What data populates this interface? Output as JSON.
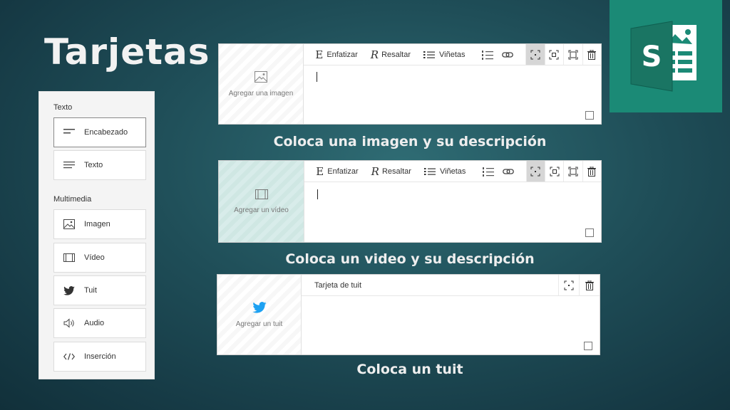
{
  "slide": {
    "title": "Tarjetas"
  },
  "logo": {
    "letter": "S",
    "color": "#1b8a76"
  },
  "panel": {
    "sections": [
      {
        "title": "Texto",
        "items": [
          {
            "label": "Encabezado",
            "icon": "heading-icon",
            "selected": true
          },
          {
            "label": "Texto",
            "icon": "text-lines-icon"
          }
        ]
      },
      {
        "title": "Multimedia",
        "items": [
          {
            "label": "Imagen",
            "icon": "image-icon"
          },
          {
            "label": "Vídeo",
            "icon": "video-icon"
          },
          {
            "label": "Tuit",
            "icon": "twitter-icon"
          },
          {
            "label": "Audio",
            "icon": "speaker-icon"
          },
          {
            "label": "Inserción",
            "icon": "embed-icon"
          }
        ]
      }
    ]
  },
  "toolbar": {
    "emphasize_glyph": "E",
    "emphasize": "Enfatizar",
    "highlight_glyph": "R",
    "highlight": "Resaltar",
    "bullets": "Viñetas"
  },
  "cards": {
    "image": {
      "media_label": "Agregar una imagen",
      "caption": "Coloca una imagen y su descripción"
    },
    "video": {
      "media_label": "Agregar un vídeo",
      "caption": "Coloca un video y su descripción"
    },
    "tweet": {
      "media_label": "Agregar un tuit",
      "header": "Tarjeta de tuit",
      "caption": "Coloca un tuit"
    }
  }
}
